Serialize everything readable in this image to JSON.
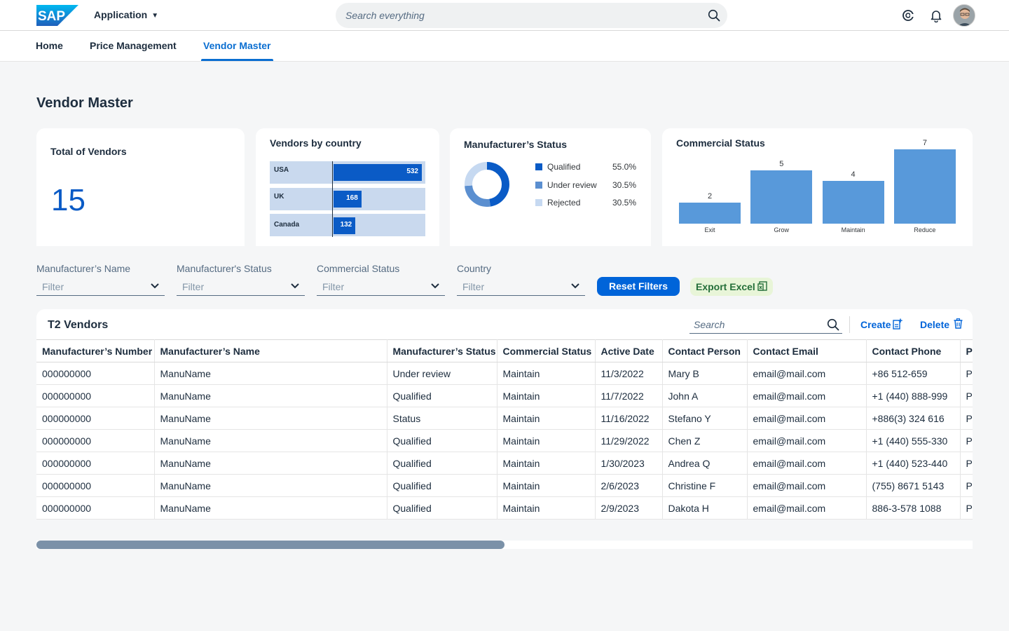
{
  "shell": {
    "logo_text": "SAP",
    "app_title": "Application",
    "search_placeholder": "Search everything"
  },
  "tabs": [
    {
      "label": "Home"
    },
    {
      "label": "Price Management"
    },
    {
      "label": "Vendor Master",
      "active": true
    }
  ],
  "page_title": "Vendor Master",
  "cards": {
    "total": {
      "title": "Total of Vendors",
      "value": "15"
    },
    "country": {
      "title": "Vendors by country"
    },
    "mstatus": {
      "title": "Manufacturer’s Status"
    },
    "cstatus": {
      "title": "Commercial Status"
    }
  },
  "chart_data": [
    {
      "type": "bar",
      "title": "Vendors by country",
      "orientation": "horizontal",
      "categories": [
        "USA",
        "UK",
        "Canada"
      ],
      "values": [
        532,
        168,
        132
      ],
      "colors": [
        "#0a5bc6"
      ]
    },
    {
      "type": "pie",
      "title": "Manufacturer’s Status",
      "donut": true,
      "labels": [
        "Qualified",
        "Under review",
        "Rejected"
      ],
      "values": [
        55.0,
        30.5,
        30.5
      ],
      "display_values": [
        "55.0%",
        "30.5%",
        "30.5%"
      ],
      "colors": [
        "#0a5bc6",
        "#5b8fd0",
        "#c6d9f1"
      ]
    },
    {
      "type": "bar",
      "title": "Commercial Status",
      "categories": [
        "Exit",
        "Grow",
        "Maintain",
        "Reduce"
      ],
      "values": [
        2,
        5,
        4,
        7
      ],
      "ylim": [
        0,
        7
      ],
      "colors": [
        "#5899da"
      ]
    }
  ],
  "filters": [
    {
      "label": "Manufacturer’s Name",
      "placeholder": "Filter"
    },
    {
      "label": "Manufacturer's Status",
      "placeholder": "Filter"
    },
    {
      "label": "Commercial Status",
      "placeholder": "Filter"
    },
    {
      "label": "Country",
      "placeholder": "Filter"
    }
  ],
  "actions": {
    "reset": "Reset Filters",
    "export": "Export Excel"
  },
  "table": {
    "title": "T2 Vendors",
    "search_placeholder": "Search",
    "create_label": "Create",
    "delete_label": "Delete",
    "columns": [
      "Manufacturer’s Number",
      "Manufacturer’s Name",
      "Manufacturer’s Status",
      "Commercial Status",
      "Active Date",
      "Contact Person",
      "Contact Email",
      "Contact Phone",
      "Po"
    ],
    "rows": [
      [
        "000000000",
        "ManuName",
        "Under review",
        "Maintain",
        "11/3/2022",
        "Mary B",
        "email@mail.com",
        "+86 512-659",
        "Po"
      ],
      [
        "000000000",
        "ManuName",
        "Qualified",
        "Maintain",
        "11/7/2022",
        "John A",
        "email@mail.com",
        "+1 (440) 888-999",
        "Po"
      ],
      [
        "000000000",
        "ManuName",
        "Status",
        "Maintain",
        "11/16/2022",
        "Stefano Y",
        "email@mail.com",
        "+886(3) 324 616",
        "Po"
      ],
      [
        "000000000",
        "ManuName",
        "Qualified",
        "Maintain",
        "11/29/2022",
        "Chen Z",
        "email@mail.com",
        "+1 (440) 555-330",
        "Po"
      ],
      [
        "000000000",
        "ManuName",
        "Qualified",
        "Maintain",
        "1/30/2023",
        "Andrea Q",
        "email@mail.com",
        "+1 (440) 523-440",
        "Po"
      ],
      [
        "000000000",
        "ManuName",
        "Qualified",
        "Maintain",
        "2/6/2023",
        "Christine F",
        "email@mail.com",
        "(755)  8671 5143",
        "Po"
      ],
      [
        "000000000",
        "ManuName",
        "Qualified",
        "Maintain",
        "2/9/2023",
        "Dakota H",
        "email@mail.com",
        "886-3-578 1088",
        "Po"
      ]
    ]
  },
  "scrollbar": {
    "position_fraction": 0.0,
    "thumb_fraction": 0.5
  },
  "icons": [
    "search-icon",
    "copilot-icon",
    "bell-icon",
    "avatar",
    "chevron-down-icon",
    "create-icon",
    "delete-icon",
    "excel-icon"
  ],
  "colors": {
    "brand_blue": "#0a6ed1",
    "emphasized_button": "#0064d9",
    "positive_bg": "#e8f5d8",
    "chart_blue": "#5899da"
  }
}
